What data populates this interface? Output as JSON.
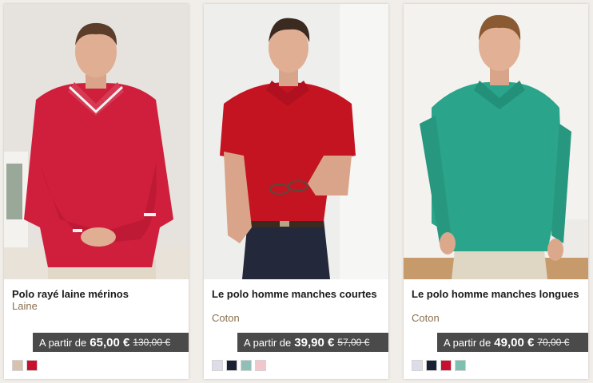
{
  "products": [
    {
      "title": "Polo rayé laine mérinos",
      "material": "Laine",
      "price_prefix": "A partir de",
      "price": "65,00 €",
      "old_price": "130,00 €",
      "swatches": [
        "#d8c2ae",
        "#c8102e"
      ],
      "image": "man-in-red-striped-knit-polo"
    },
    {
      "title": "Le polo homme manches courtes",
      "material": "Coton",
      "price_prefix": "A partir de",
      "price": "39,90 €",
      "old_price": "57,00 €",
      "swatches": [
        "#dcdde8",
        "#1b2133",
        "#8fbfb6",
        "#f3c6cc"
      ],
      "image": "man-in-red-short-sleeve-polo"
    },
    {
      "title": "Le polo homme manches longues",
      "material": "Coton",
      "price_prefix": "A partir de",
      "price": "49,00 €",
      "old_price": "70,00 €",
      "swatches": [
        "#dcdde8",
        "#1b2133",
        "#c8102e",
        "#7ec0b0"
      ],
      "image": "man-in-green-long-sleeve-polo"
    }
  ],
  "colors": {
    "price_bg": "#4a4a4a",
    "material_text": "#8a6f4f",
    "page_bg": "#f1ede9"
  }
}
